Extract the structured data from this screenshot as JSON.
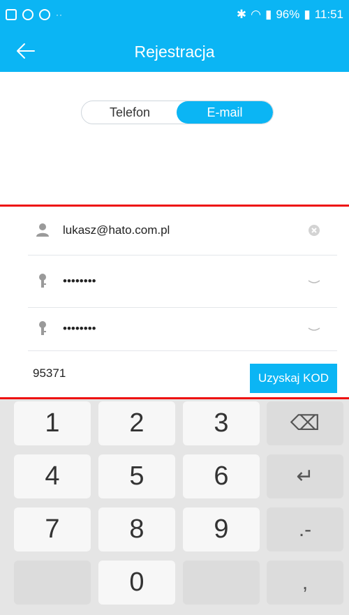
{
  "statusbar": {
    "battery_percent": "96%",
    "time": "11:51",
    "dots": "··"
  },
  "appbar": {
    "title": "Rejestracja"
  },
  "segment": {
    "left_label": "Telefon",
    "right_label": "E-mail",
    "active": "right"
  },
  "form": {
    "email_value": "lukasz@hato.com.pl",
    "password_value": "••••••••",
    "confirm_password_value": "••••••••",
    "code_value": "95371",
    "get_code_label": "Uzyskaj KOD"
  },
  "keyboard": {
    "keys": [
      "1",
      "2",
      "3",
      "⌫",
      "4",
      "5",
      "6",
      "↵",
      "7",
      "8",
      "9",
      ".-",
      "",
      "0",
      "",
      ","
    ]
  }
}
